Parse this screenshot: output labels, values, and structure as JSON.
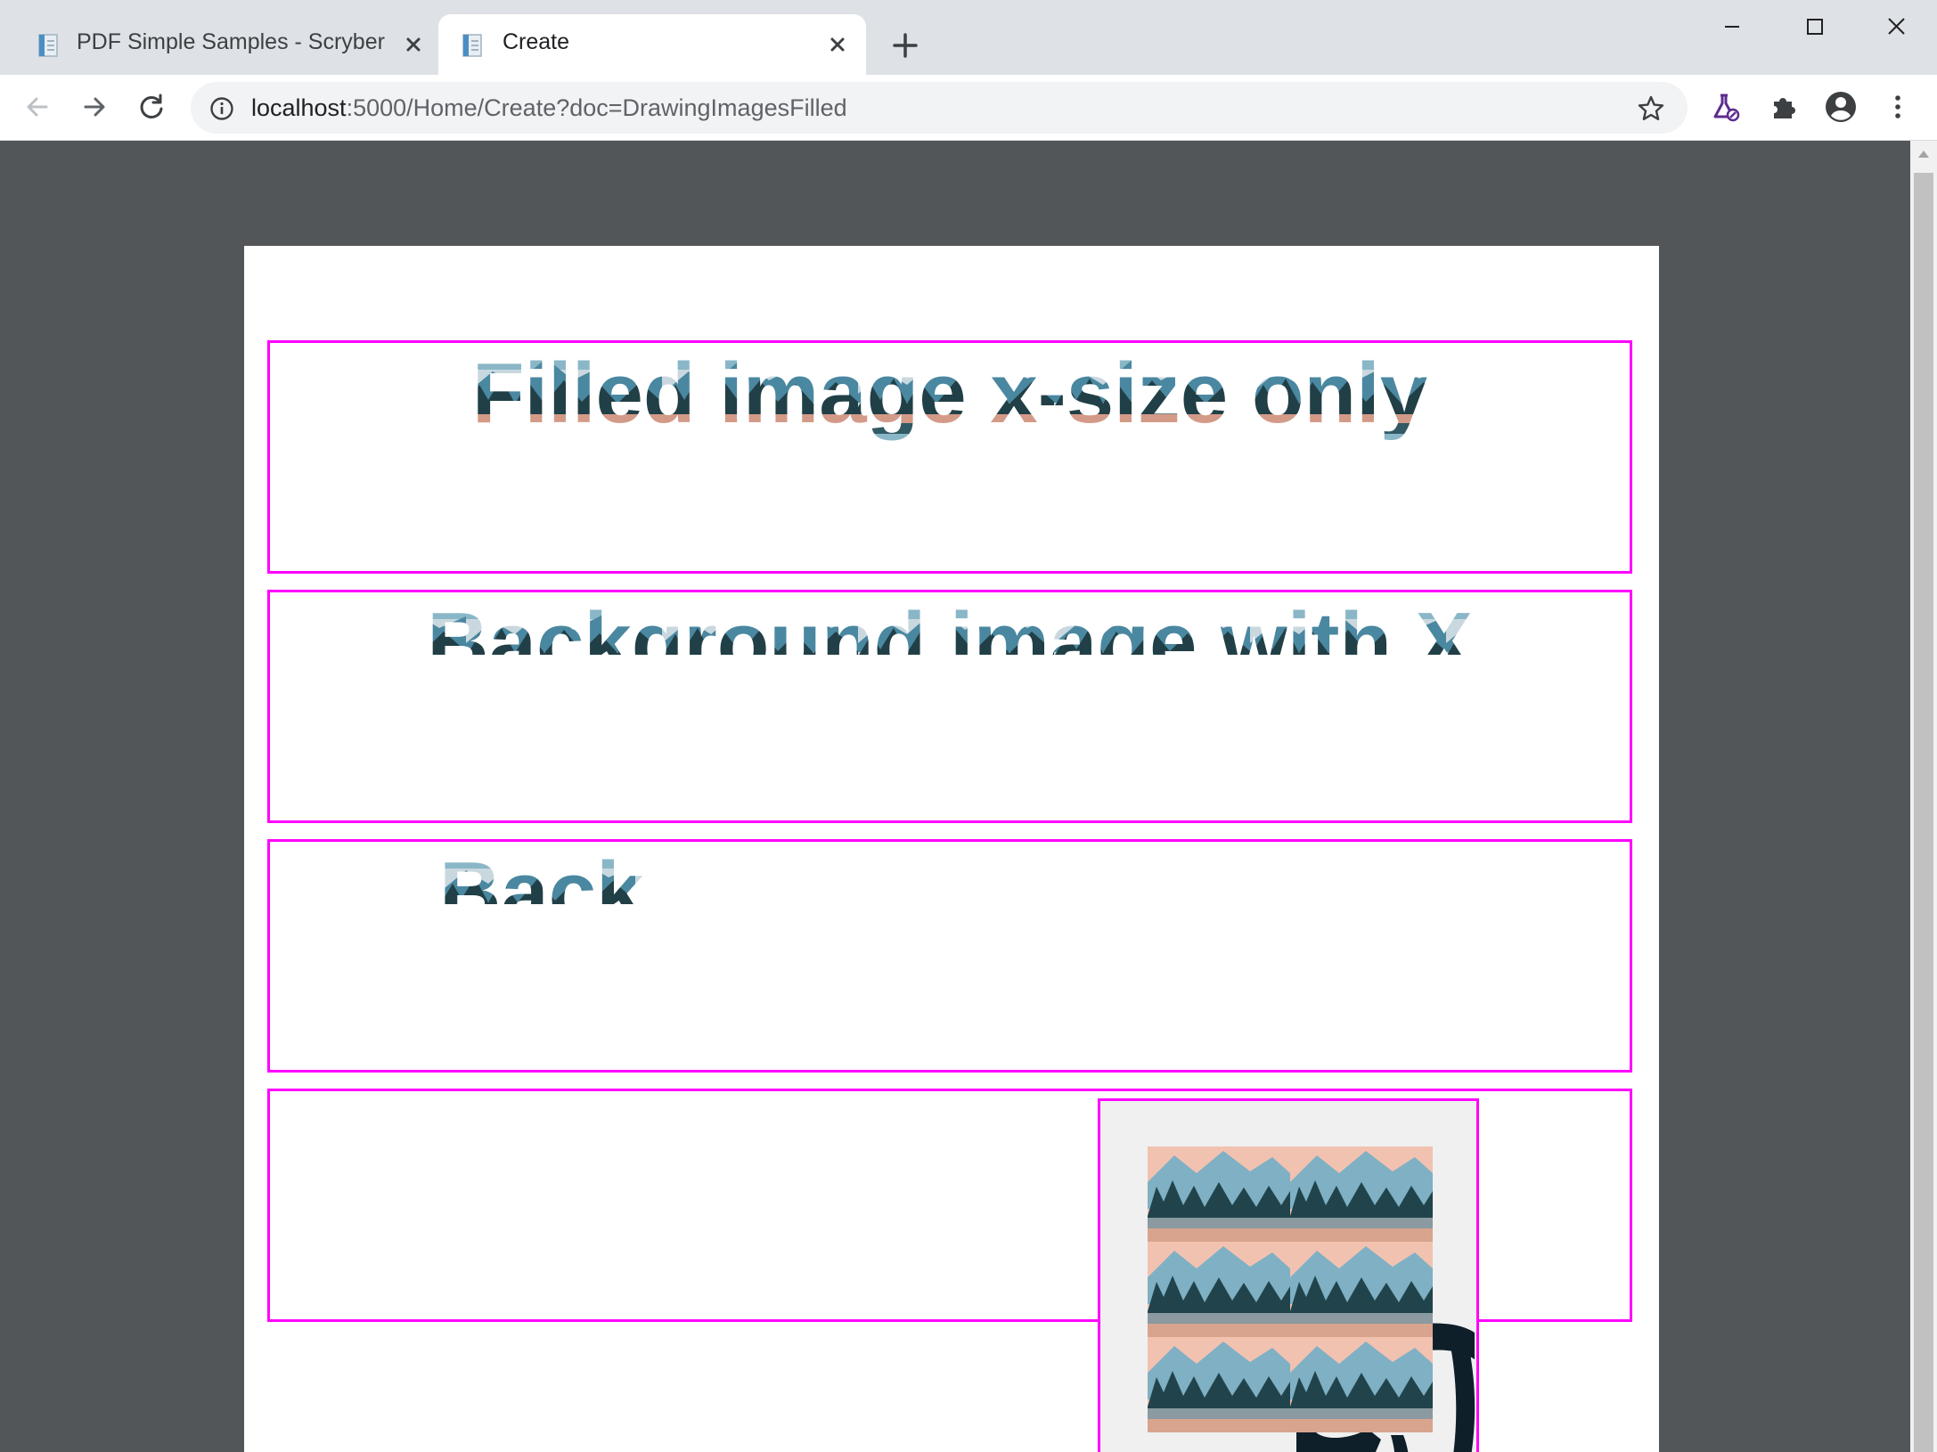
{
  "browser": {
    "tabs": [
      {
        "title": "PDF Simple Samples - Scryber",
        "active": false
      },
      {
        "title": "Create",
        "active": true
      }
    ],
    "address": {
      "host": "localhost",
      "path": ":5000/Home/Create?doc=DrawingImagesFilled"
    },
    "icons": {
      "favicon": "pdf-document-icon",
      "close": "close-icon",
      "new_tab": "plus-icon",
      "back": "arrow-left-icon",
      "forward": "arrow-right-icon",
      "reload": "reload-icon",
      "site_info": "info-icon",
      "bookmark": "star-icon",
      "labs": "flask-icon",
      "extensions": "puzzle-icon",
      "profile": "account-circle-icon",
      "menu": "kebab-menu-icon"
    }
  },
  "document": {
    "headings": [
      "Filled image x-size only",
      "Background image with X",
      "Back"
    ],
    "border_color": "#ff00ff",
    "fill_image": "mountain-lake-landscape"
  }
}
